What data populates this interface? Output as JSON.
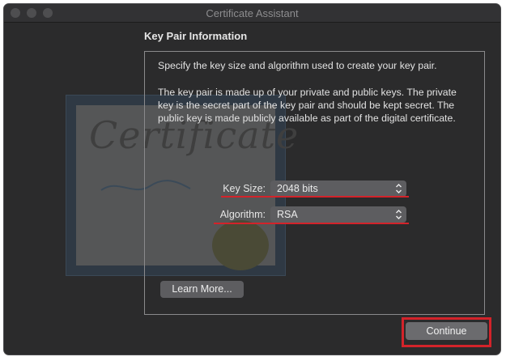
{
  "window": {
    "title": "Certificate Assistant"
  },
  "background": {
    "watermark_text": "Certificate"
  },
  "page": {
    "heading": "Key Pair Information",
    "intro": "Specify the key size and algorithm used to create your key pair.",
    "description": "The key pair is made up of your private and public keys. The private key is the secret part of the key pair and should be kept secret. The public key is made publicly available as part of the digital certificate."
  },
  "form": {
    "key_size": {
      "label": "Key Size:",
      "value": "2048 bits"
    },
    "algorithm": {
      "label": "Algorithm:",
      "value": "RSA"
    }
  },
  "buttons": {
    "learn_more": "Learn More...",
    "continue": "Continue"
  },
  "colors": {
    "annotation_red": "#d3232a",
    "window_bg": "#2b2b2c"
  }
}
